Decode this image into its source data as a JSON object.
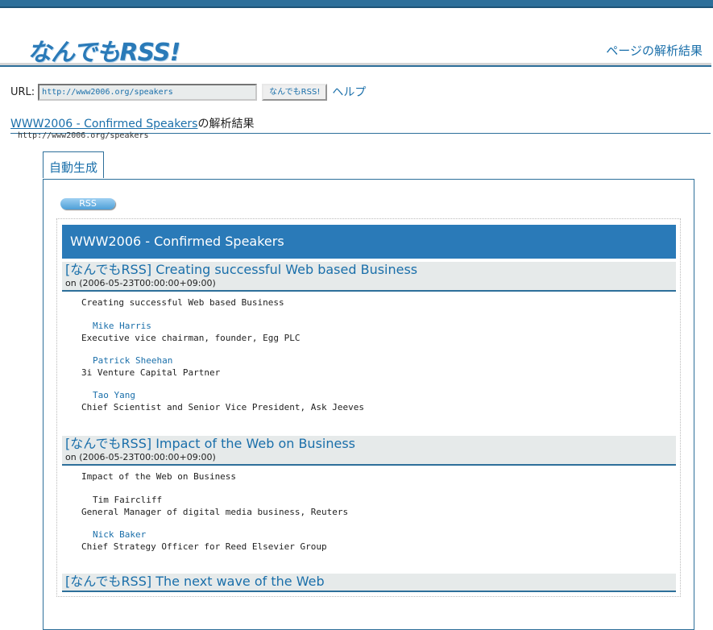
{
  "header": {
    "logo": "なんでもRSS!",
    "result_link": "ページの解析結果"
  },
  "form": {
    "url_label": "URL:",
    "url_value": "http://www2006.org/speakers",
    "submit_label": "なんでもRSS!",
    "help_label": "ヘルプ"
  },
  "result": {
    "page_title": "WWW2006 - Confirmed Speakers",
    "suffix": "の解析結果",
    "page_url": "http://www2006.org/speakers"
  },
  "tab": {
    "label": "自動生成"
  },
  "rss_badge": "RSS",
  "feed": {
    "title": "WWW2006 - Confirmed Speakers",
    "items": [
      {
        "title": "[なんでもRSS] Creating successful Web based Business",
        "date": "on (2006-05-23T00:00:00+09:00)",
        "desc": "Creating successful Web based Business",
        "people": [
          {
            "name": "Mike Harris",
            "role": "Executive vice chairman, founder, Egg PLC",
            "link": true
          },
          {
            "name": "Patrick Sheehan",
            "role": "3i Venture Capital Partner",
            "link": true
          },
          {
            "name": "Tao Yang",
            "role": "Chief Scientist and Senior Vice President, Ask Jeeves",
            "link": true
          }
        ]
      },
      {
        "title": "[なんでもRSS] Impact of the Web on Business",
        "date": "on (2006-05-23T00:00:00+09:00)",
        "desc": "Impact of the Web on Business",
        "people": [
          {
            "name": "Tim Faircliff",
            "role": "General Manager of digital media business, Reuters",
            "link": false
          },
          {
            "name": "Nick Baker",
            "role": "Chief Strategy Officer for Reed Elsevier Group",
            "link": true
          }
        ]
      },
      {
        "title": "[なんでもRSS] The next wave of the Web"
      }
    ]
  },
  "colors": {
    "accent": "#2a7ab8",
    "link": "#1a6faa",
    "item_bg": "#e6eaea"
  }
}
